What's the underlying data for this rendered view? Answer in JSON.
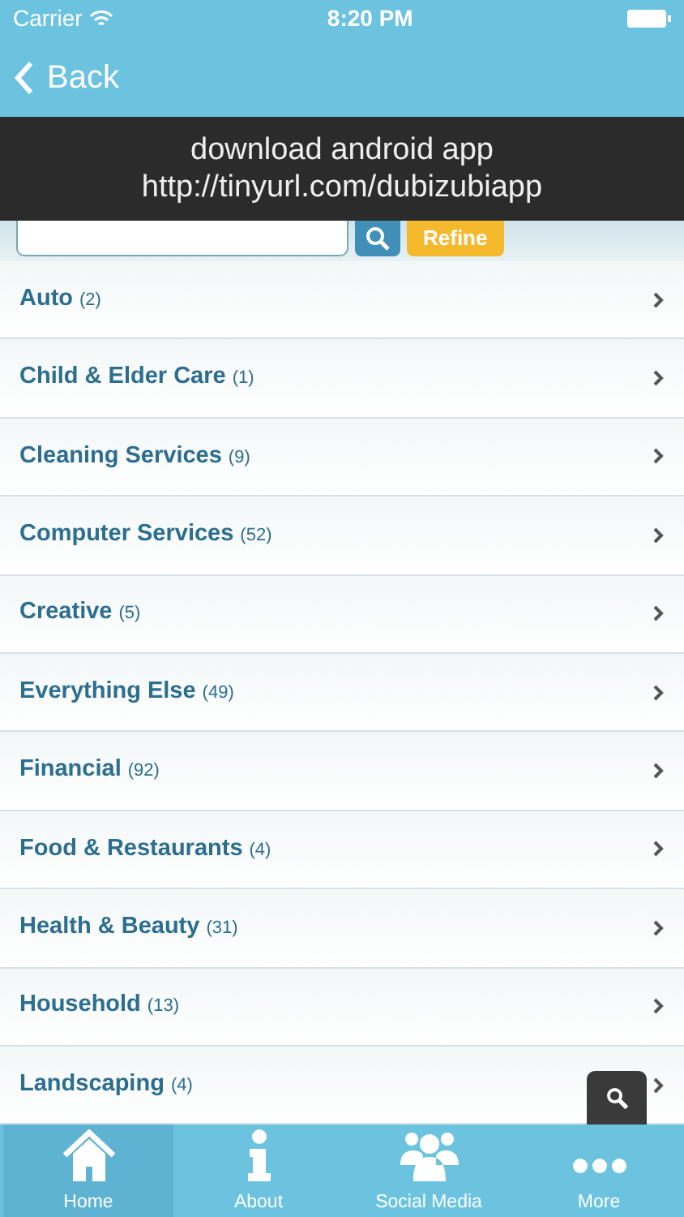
{
  "status_bar": {
    "carrier": "Carrier",
    "time": "8:20 PM"
  },
  "nav": {
    "back": "Back"
  },
  "banner": {
    "line_1": "download android app",
    "line_2": "http://tinyurl.com/dubizubiapp"
  },
  "search": {
    "button": "Refine"
  },
  "categories": [
    {
      "name": "Auto",
      "count": "(2)"
    },
    {
      "name": "Child & Elder Care",
      "count": "(1)"
    },
    {
      "name": "Cleaning Services",
      "count": "(9)"
    },
    {
      "name": "Computer Services",
      "count": "(52)"
    },
    {
      "name": "Creative",
      "count": "(5)"
    },
    {
      "name": "Everything Else",
      "count": "(49)"
    },
    {
      "name": "Financial",
      "count": "(92)"
    },
    {
      "name": "Food & Restaurants",
      "count": "(4)"
    },
    {
      "name": "Health & Beauty",
      "count": "(31)"
    },
    {
      "name": "Household",
      "count": "(13)"
    },
    {
      "name": "Landscaping",
      "count": "(4)"
    }
  ],
  "tabs": [
    {
      "label": "Home",
      "kind": "home",
      "selected": true
    },
    {
      "label": "About",
      "kind": "info",
      "selected": false
    },
    {
      "label": "Social Media",
      "kind": "people",
      "selected": false
    },
    {
      "label": "More",
      "kind": "more",
      "selected": false
    }
  ]
}
